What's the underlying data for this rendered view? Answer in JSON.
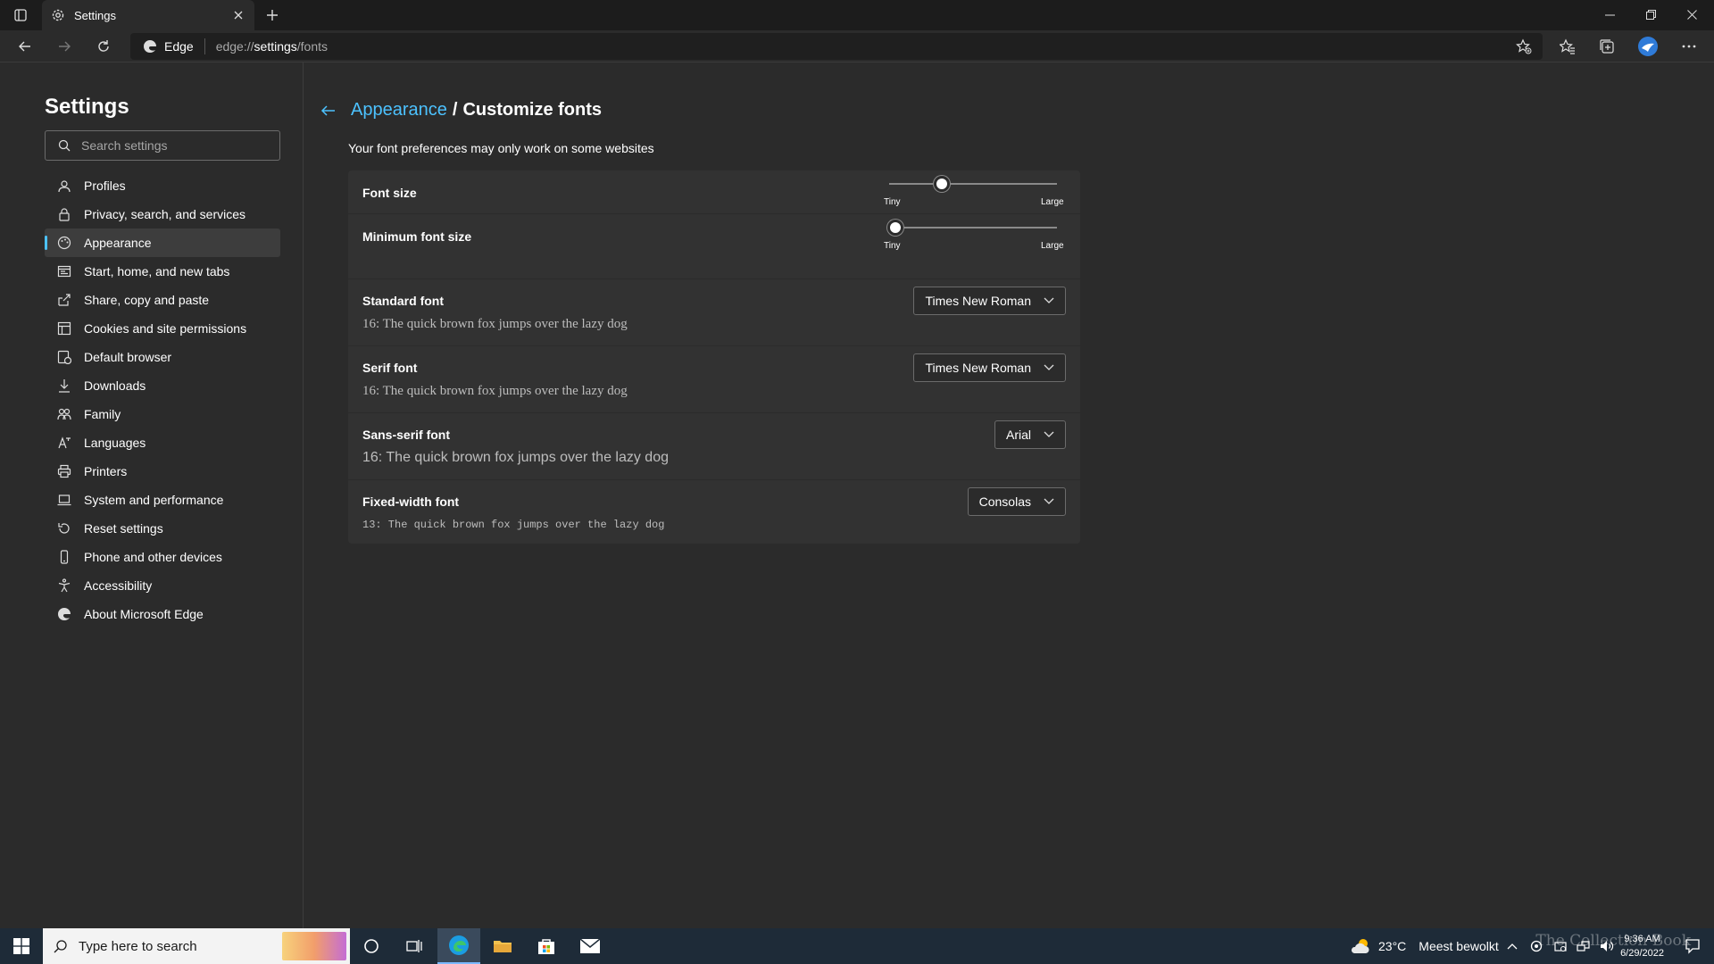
{
  "tab": {
    "title": "Settings"
  },
  "address": {
    "engine_label": "Edge",
    "url_prefix": "edge://",
    "url_bold": "settings",
    "url_suffix": "/fonts"
  },
  "sidebar": {
    "title": "Settings",
    "search_placeholder": "Search settings",
    "items": [
      {
        "label": "Profiles",
        "icon": "profile-icon"
      },
      {
        "label": "Privacy, search, and services",
        "icon": "lock-icon"
      },
      {
        "label": "Appearance",
        "icon": "appearance-icon",
        "active": true
      },
      {
        "label": "Start, home, and new tabs",
        "icon": "home-icon"
      },
      {
        "label": "Share, copy and paste",
        "icon": "share-icon"
      },
      {
        "label": "Cookies and site permissions",
        "icon": "cookies-icon"
      },
      {
        "label": "Default browser",
        "icon": "browser-icon"
      },
      {
        "label": "Downloads",
        "icon": "download-icon"
      },
      {
        "label": "Family",
        "icon": "family-icon"
      },
      {
        "label": "Languages",
        "icon": "languages-icon"
      },
      {
        "label": "Printers",
        "icon": "printer-icon"
      },
      {
        "label": "System and performance",
        "icon": "laptop-icon"
      },
      {
        "label": "Reset settings",
        "icon": "reset-icon"
      },
      {
        "label": "Phone and other devices",
        "icon": "phone-icon"
      },
      {
        "label": "Accessibility",
        "icon": "accessibility-icon"
      },
      {
        "label": "About Microsoft Edge",
        "icon": "edge-icon"
      }
    ]
  },
  "main": {
    "breadcrumb_link": "Appearance",
    "breadcrumb_sep": "/",
    "breadcrumb_title": "Customize fonts",
    "note": "Your font preferences may only work on some websites",
    "font_size": {
      "label": "Font size",
      "min_label": "Tiny",
      "max_label": "Large",
      "level": 0.3
    },
    "min_font_size": {
      "label": "Minimum font size",
      "min_label": "Tiny",
      "max_label": "Large",
      "level": 0.0
    },
    "fonts": [
      {
        "label": "Standard font",
        "value": "Times New Roman",
        "sample": "16: The quick brown fox jumps over the lazy dog"
      },
      {
        "label": "Serif font",
        "value": "Times New Roman",
        "sample": "16: The quick brown fox jumps over the lazy dog"
      },
      {
        "label": "Sans-serif font",
        "value": "Arial",
        "sample": "16: The quick brown fox jumps over the lazy dog"
      },
      {
        "label": "Fixed-width font",
        "value": "Consolas",
        "sample": "13: The quick brown fox jumps over the lazy dog"
      }
    ]
  },
  "taskbar": {
    "search_placeholder": "Type here to search",
    "weather_temp": "23°C",
    "weather_text": "Meest bewolkt",
    "time": "9:36 AM",
    "date": "6/29/2022",
    "watermark": "The Collection Book"
  },
  "colors": {
    "accent": "#4cc2ff",
    "background": "#2b2b2b",
    "card": "#323232",
    "taskbar": "#1e2b38"
  }
}
